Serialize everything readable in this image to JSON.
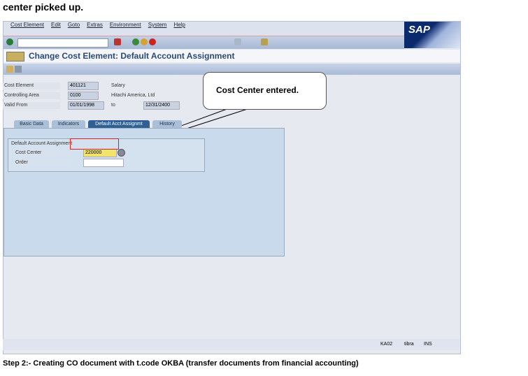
{
  "top_text": "center picked up.",
  "menu": [
    "Cost Element",
    "Edit",
    "Goto",
    "Extras",
    "Environment",
    "System",
    "Help"
  ],
  "logo": "SAP",
  "title": "Change Cost Element: Default Account Assignment",
  "fields": [
    {
      "label": "Cost Element",
      "value": "401121",
      "desc": "Salary"
    },
    {
      "label": "Controlling Area",
      "value": "0100",
      "desc": "Hitachi America, Ltd"
    },
    {
      "label": "Valid From",
      "value": "01/01/1998",
      "to_label": "to",
      "to_value": "12/31/2400"
    }
  ],
  "callout": "Cost Center entered.",
  "tabs": [
    "Basic Data",
    "Indicators",
    "Default Acct Assignmt",
    "History"
  ],
  "group_title": "Default Account Assignment",
  "cost_center_label": "Cost Center",
  "cost_center_value": "220000",
  "order_label": "Order",
  "order_value": "",
  "status": {
    "tcode": "KA02",
    "server": "tibra",
    "mode": "INS"
  },
  "caption": "Step 2:- Creating CO document with t.code OKBA (transfer documents from financial accounting)"
}
